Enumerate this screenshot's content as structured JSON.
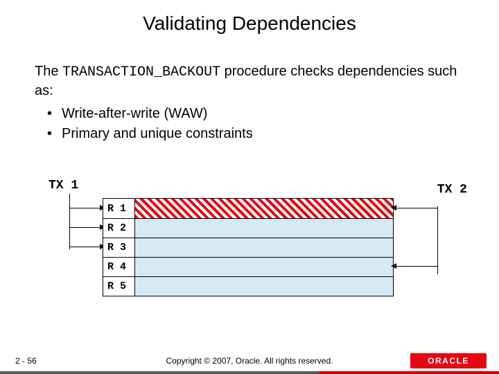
{
  "title": "Validating Dependencies",
  "intro": {
    "prefix": "The ",
    "proc": "TRANSACTION_BACKOUT",
    "suffix": " procedure checks dependencies such as:"
  },
  "bullets": [
    "Write-after-write (WAW)",
    "Primary and unique constraints"
  ],
  "diagram": {
    "tx1": "TX 1",
    "tx2": "TX 2",
    "rows": [
      "R 1",
      "R 2",
      "R 3",
      "R 4",
      "R 5"
    ]
  },
  "footer": {
    "page": "2 - 56",
    "copyright": "Copyright © 2007, Oracle. All rights reserved.",
    "logo": "ORACLE"
  }
}
